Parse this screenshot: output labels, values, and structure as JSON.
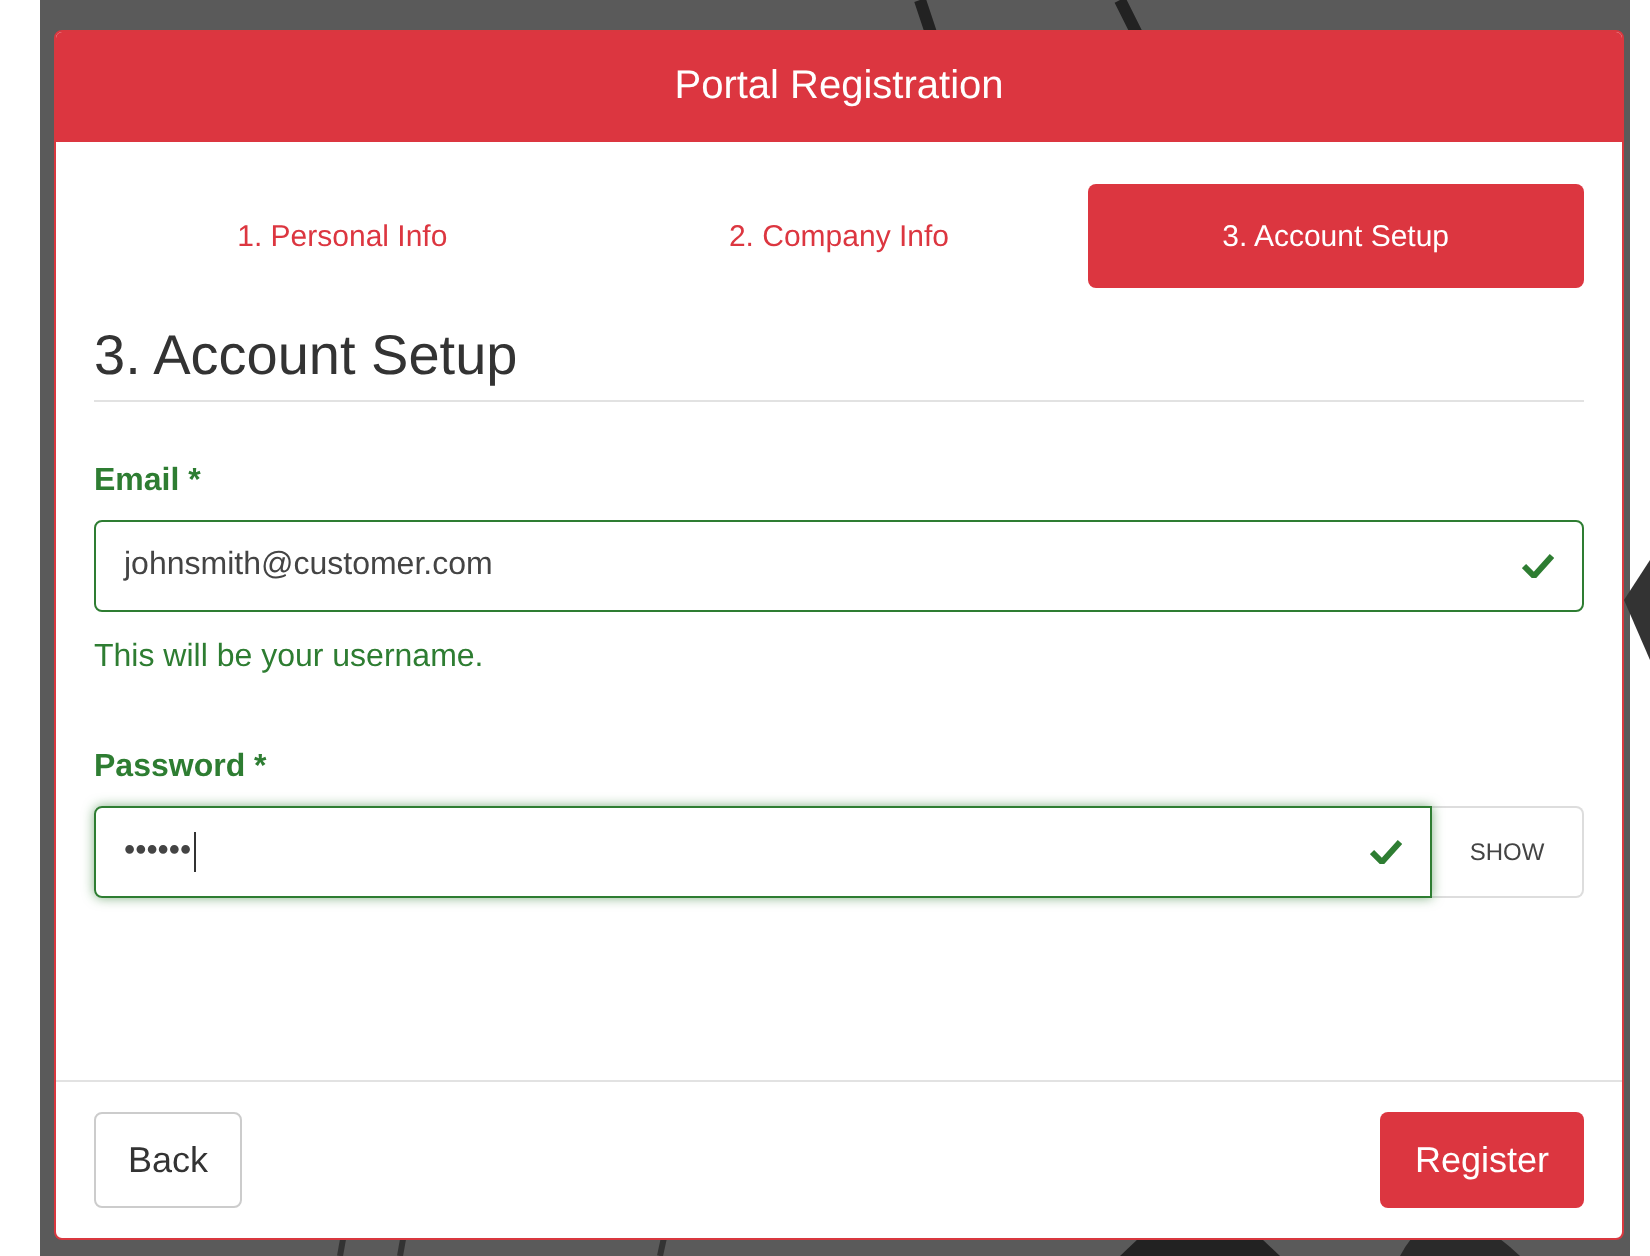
{
  "dialog": {
    "title": "Portal Registration"
  },
  "steps": [
    {
      "label": "1. Personal Info",
      "selected": false
    },
    {
      "label": "2. Company Info",
      "selected": false
    },
    {
      "label": "3. Account Setup",
      "selected": true
    }
  ],
  "section": {
    "title": "3. Account Setup"
  },
  "fields": [
    {
      "label": "Email *",
      "value": "johnsmith@customer.com",
      "valid": true,
      "focused": false,
      "help": "This will be your username."
    },
    {
      "label": "Password *",
      "value": "••••••",
      "valid": true,
      "focused": true,
      "addon": "SHOW"
    }
  ],
  "buttons": {
    "back": "Back",
    "submit": "Register"
  }
}
